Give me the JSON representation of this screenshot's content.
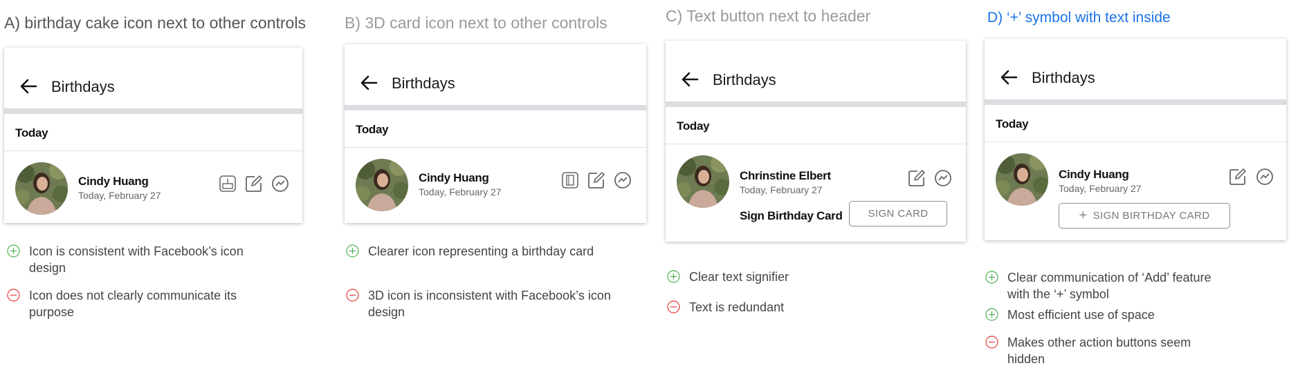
{
  "panels": [
    {
      "title": "A) birthday cake icon next to other controls",
      "title_color": "#555555",
      "header_title": "Birthdays",
      "section_label": "Today",
      "person_name": "Cindy Huang",
      "person_date": "Today, February 27",
      "icons": [
        "birthday-cake-icon",
        "edit-icon",
        "messenger-icon"
      ],
      "notes": [
        {
          "type": "plus",
          "lines": [
            "Icon is consistent with Facebook’s icon",
            "design"
          ]
        },
        {
          "type": "minus",
          "lines": [
            "Icon does not clearly communicate its",
            "purpose"
          ]
        }
      ]
    },
    {
      "title": "B) 3D card icon next to other controls",
      "title_color": "#9a9a9a",
      "header_title": "Birthdays",
      "section_label": "Today",
      "person_name": "Cindy Huang",
      "person_date": "Today, February 27",
      "icons": [
        "3d-card-icon",
        "edit-icon",
        "messenger-icon"
      ],
      "notes": [
        {
          "type": "plus",
          "lines": [
            "Clearer icon representing a birthday card"
          ]
        },
        {
          "type": "minus",
          "lines": [
            "3D icon is inconsistent with Facebook’s icon",
            "design"
          ]
        }
      ]
    },
    {
      "title": "C) Text button next to header",
      "title_color": "#9a9a9a",
      "header_title": "Birthdays",
      "section_label": "Today",
      "person_name": "Chrinstine Elbert",
      "person_date": "Today, February 27",
      "icons": [
        "edit-icon",
        "messenger-icon"
      ],
      "action_label": "Sign Birthday Card",
      "button_label": "SIGN CARD",
      "notes": [
        {
          "type": "plus",
          "lines": [
            "Clear text signifier"
          ]
        },
        {
          "type": "minus",
          "lines": [
            "Text is redundant"
          ]
        }
      ]
    },
    {
      "title": "D) ‘+’ symbol with text inside",
      "title_color": "#1a73e8",
      "header_title": "Birthdays",
      "section_label": "Today",
      "person_name": "Cindy Huang",
      "person_date": "Today, February 27",
      "icons": [
        "edit-icon",
        "messenger-icon"
      ],
      "button_label": "SIGN BIRTHDAY CARD",
      "button_prefix": "+",
      "notes": [
        {
          "type": "plus",
          "lines": [
            "Clear communication of ‘Add’ feature",
            "with the ‘+’ symbol"
          ]
        },
        {
          "type": "plus",
          "lines": [
            "Most efficient use of space"
          ]
        },
        {
          "type": "minus",
          "lines": [
            "Makes other action buttons seem",
            "hidden"
          ]
        }
      ]
    }
  ],
  "colors": {
    "plus": "#4caf50",
    "minus": "#e53935",
    "title_d": "#1a73e8"
  }
}
